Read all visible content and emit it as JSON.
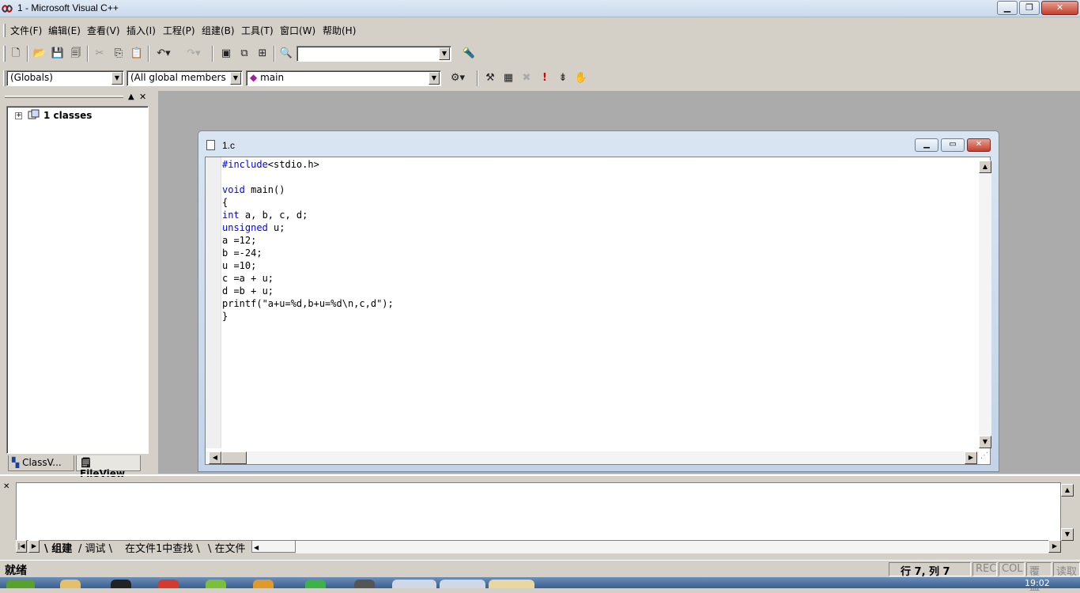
{
  "window": {
    "title": "1 - Microsoft Visual C++",
    "min": "0",
    "max": "1",
    "close": "r"
  },
  "menu": [
    "文件(F)",
    "编辑(E)",
    "查看(V)",
    "插入(I)",
    "工程(P)",
    "组建(B)",
    "工具(T)",
    "窗口(W)",
    "帮助(H)"
  ],
  "wizardbar": {
    "scope": "(Globals)",
    "members": "(All global members",
    "function": "main"
  },
  "workspace": {
    "tree_root": "1 classes",
    "tabs": [
      "ClassV...",
      "FileView"
    ]
  },
  "editor": {
    "filename": "1.c",
    "code": [
      {
        "kw": "#include",
        "rest": "<stdio.h>"
      },
      {
        "kw": "",
        "rest": ""
      },
      {
        "kw": "void",
        "rest": " main()"
      },
      {
        "kw": "",
        "rest": "{"
      },
      {
        "kw": "int",
        "rest": " a, b, c, d;"
      },
      {
        "kw": "unsigned",
        "rest": " u;"
      },
      {
        "kw": "",
        "rest": "a =12;"
      },
      {
        "kw": "",
        "rest": "b =-24;"
      },
      {
        "kw": "",
        "rest": "u =10;"
      },
      {
        "kw": "",
        "rest": "c =a + u;"
      },
      {
        "kw": "",
        "rest": "d =b + u;"
      },
      {
        "kw": "",
        "rest": "printf(\"a+u=%d,b+u=%d\\n,c,d\");"
      },
      {
        "kw": "",
        "rest": "}"
      }
    ]
  },
  "output": {
    "tabs": [
      "组建",
      "调试",
      "在文件1中查找",
      "在文件"
    ]
  },
  "status": {
    "text": "就绪",
    "position": "行 7, 列 7",
    "rec": "REC",
    "col": "COL",
    "ovr": "覆盖",
    "read": "读取"
  },
  "taskbar": {
    "clock": "19:02"
  }
}
